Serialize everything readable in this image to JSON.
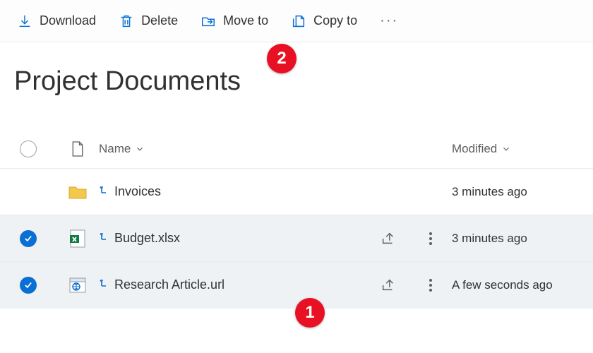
{
  "toolbar": {
    "download_label": "Download",
    "delete_label": "Delete",
    "move_to_label": "Move to",
    "copy_to_label": "Copy to"
  },
  "page_title": "Project Documents",
  "columns": {
    "name": "Name",
    "modified": "Modified"
  },
  "rows": [
    {
      "selected": false,
      "type": "folder",
      "name": "Invoices",
      "modified": "3 minutes ago",
      "show_actions": false
    },
    {
      "selected": true,
      "type": "xlsx",
      "name": "Budget.xlsx",
      "modified": "3 minutes ago",
      "show_actions": true
    },
    {
      "selected": true,
      "type": "url",
      "name": "Research Article.url",
      "modified": "A few seconds ago",
      "show_actions": true
    }
  ],
  "callouts": {
    "c1": "1",
    "c2": "2"
  }
}
